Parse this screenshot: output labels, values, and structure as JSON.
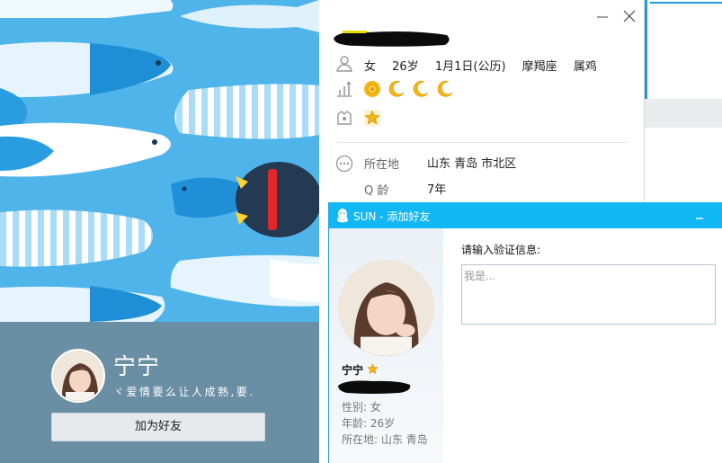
{
  "card": {
    "name": "宁宁",
    "signature": "ヾ爱情要么让人成熟,要.",
    "add_friend_label": "加为好友"
  },
  "profile": {
    "gender": "女",
    "age": "26岁",
    "birthday": "1月1日(公历)",
    "zodiac": "摩羯座",
    "chinese_zodiac": "属鸡",
    "level_icons": [
      "sun-icon",
      "moon-icon",
      "moon-icon",
      "moon-icon"
    ],
    "location_label": "所在地",
    "location_value": "山东 青岛 市北区",
    "qage_label": "Q 龄",
    "qage_value": "7年"
  },
  "dialog": {
    "title": "SUN - 添加好友",
    "prompt": "请输入验证信息:",
    "input_placeholder": "我是...",
    "name": "宁宁",
    "gender_line": "性别: 女",
    "age_line": "年龄: 26岁",
    "location_line": "所在地: 山东  青岛"
  },
  "colors": {
    "dialog_titlebar": "#12b7f5",
    "card_bottom": "#6a8ea3",
    "level_sun": "#f5b618",
    "level_moon": "#f5b618"
  }
}
